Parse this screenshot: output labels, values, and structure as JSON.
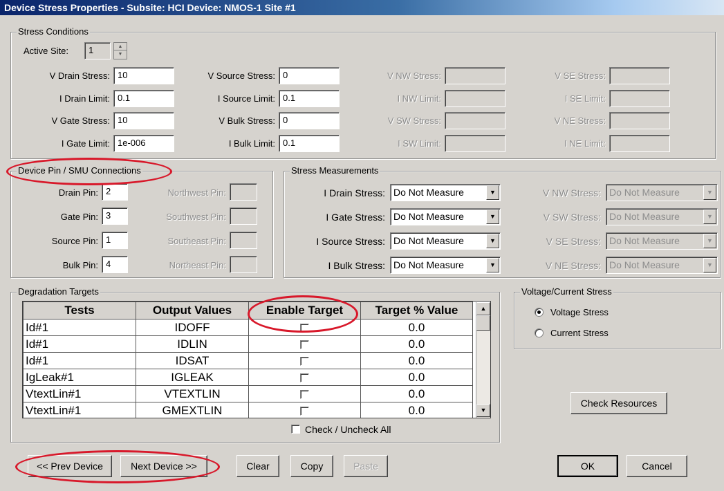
{
  "window": {
    "title": "Device Stress Properties -  Subsite: HCI  Device: NMOS-1  Site #1"
  },
  "stress_conditions": {
    "legend": "Stress Conditions",
    "active_site_label": "Active Site:",
    "active_site_value": "1",
    "col1": [
      {
        "label": "V Drain Stress:",
        "value": "10"
      },
      {
        "label": "I Drain Limit:",
        "value": "0.1"
      },
      {
        "label": "V Gate Stress:",
        "value": "10"
      },
      {
        "label": "I Gate Limit:",
        "value": "1e-006"
      }
    ],
    "col2": [
      {
        "label": "V Source Stress:",
        "value": "0"
      },
      {
        "label": "I Source Limit:",
        "value": "0.1"
      },
      {
        "label": "V Bulk Stress:",
        "value": "0"
      },
      {
        "label": "I Bulk Limit:",
        "value": "0.1"
      }
    ],
    "col3": [
      {
        "label": "V NW Stress:",
        "value": ""
      },
      {
        "label": "I NW Limit:",
        "value": ""
      },
      {
        "label": "V SW Stress:",
        "value": ""
      },
      {
        "label": "I SW Limit:",
        "value": ""
      }
    ],
    "col4": [
      {
        "label": "V SE Stress:",
        "value": ""
      },
      {
        "label": "I SE Limit:",
        "value": ""
      },
      {
        "label": "V NE Stress:",
        "value": ""
      },
      {
        "label": "I NE Limit:",
        "value": ""
      }
    ]
  },
  "pin_connections": {
    "legend": "Device Pin / SMU Connections",
    "pins": [
      {
        "label": "Drain Pin:",
        "value": "2"
      },
      {
        "label": "Gate Pin:",
        "value": "3"
      },
      {
        "label": "Source Pin:",
        "value": "1"
      },
      {
        "label": "Bulk Pin:",
        "value": "4"
      }
    ],
    "corner_pins": [
      {
        "label": "Northwest Pin:",
        "value": ""
      },
      {
        "label": "Southwest Pin:",
        "value": ""
      },
      {
        "label": "Southeast Pin:",
        "value": ""
      },
      {
        "label": "Northeast Pin:",
        "value": ""
      }
    ]
  },
  "stress_measurements": {
    "legend": "Stress Measurements",
    "enabled": [
      {
        "label": "I Drain Stress:",
        "value": "Do Not Measure"
      },
      {
        "label": "I Gate Stress:",
        "value": "Do Not Measure"
      },
      {
        "label": "I Source Stress:",
        "value": "Do Not Measure"
      },
      {
        "label": "I Bulk Stress:",
        "value": "Do Not Measure"
      }
    ],
    "disabled": [
      {
        "label": "V NW Stress:",
        "value": "Do Not Measure"
      },
      {
        "label": "V SW Stress:",
        "value": "Do Not Measure"
      },
      {
        "label": "V SE Stress:",
        "value": "Do Not Measure"
      },
      {
        "label": "V NE Stress:",
        "value": "Do Not Measure"
      }
    ]
  },
  "degradation_targets": {
    "legend": "Degradation Targets",
    "columns": [
      "Tests",
      "Output Values",
      "Enable Target",
      "Target % Value"
    ],
    "rows": [
      {
        "test": "Id#1",
        "output": "IDOFF",
        "enabled": false,
        "target": "0.0"
      },
      {
        "test": "Id#1",
        "output": "IDLIN",
        "enabled": false,
        "target": "0.0"
      },
      {
        "test": "Id#1",
        "output": "IDSAT",
        "enabled": false,
        "target": "0.0"
      },
      {
        "test": "IgLeak#1",
        "output": "IGLEAK",
        "enabled": false,
        "target": "0.0"
      },
      {
        "test": "VtextLin#1",
        "output": "VTEXTLIN",
        "enabled": false,
        "target": "0.0"
      },
      {
        "test": "VtextLin#1",
        "output": "GMEXTLIN",
        "enabled": false,
        "target": "0.0"
      }
    ],
    "check_all_label": "Check / Uncheck All"
  },
  "voltage_current": {
    "legend": "Voltage/Current Stress",
    "options": [
      "Voltage Stress",
      "Current Stress"
    ],
    "selected": "Voltage Stress"
  },
  "buttons": {
    "check_resources": "Check Resources",
    "prev_device": "<< Prev Device",
    "next_device": "Next Device >>",
    "clear": "Clear",
    "copy": "Copy",
    "paste": "Paste",
    "ok": "OK",
    "cancel": "Cancel"
  },
  "colors": {
    "annotation": "#d8182a",
    "dialog_bg": "#d6d3ce",
    "title_bar": "#0a246a"
  },
  "icons": {
    "spin_up": "triangle-up",
    "spin_down": "triangle-down",
    "dropdown": "triangle-down",
    "scroll_up": "triangle-up",
    "scroll_down": "triangle-down"
  }
}
